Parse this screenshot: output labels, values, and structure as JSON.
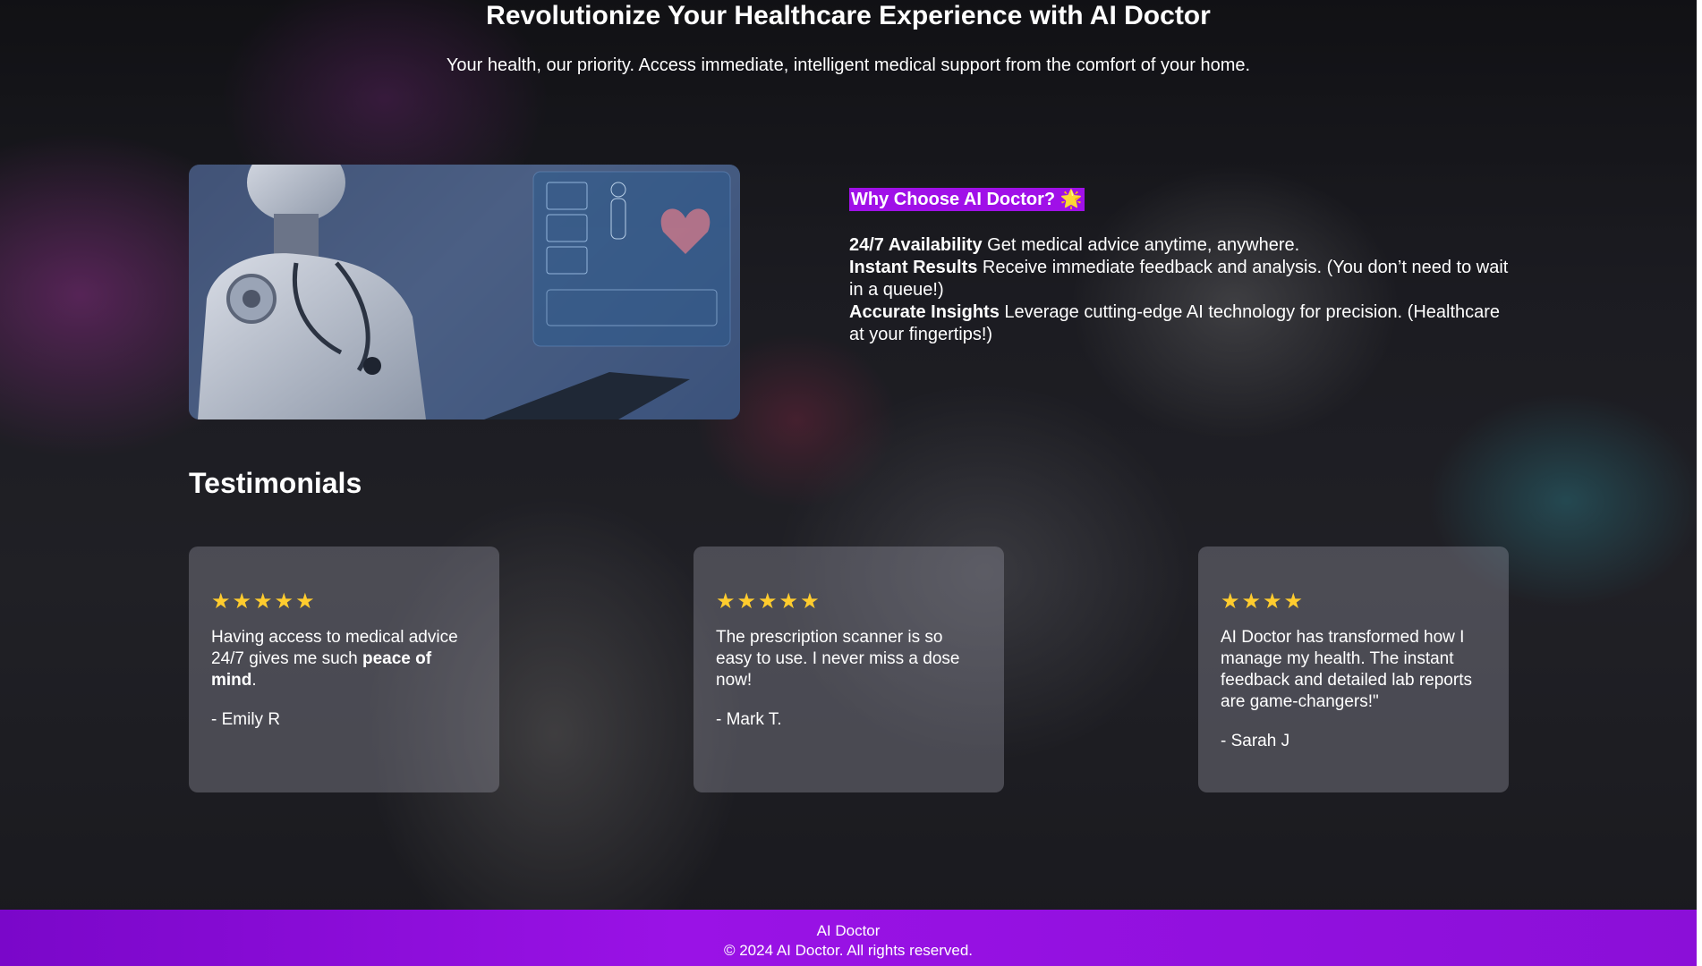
{
  "hero": {
    "title": "Revolutionize Your Healthcare Experience with AI Doctor",
    "subtitle": "Your health, our priority. Access immediate, intelligent medical support from the comfort of your home."
  },
  "why": {
    "heading": "Why Choose AI Doctor? 🌟",
    "items": [
      {
        "title": "24/7 Availability",
        "text": "Get medical advice anytime, anywhere."
      },
      {
        "title": "Instant Results",
        "text": "Receive immediate feedback and analysis. (You don’t need to wait in a queue!)"
      },
      {
        "title": "Accurate Insights",
        "text": "Leverage cutting-edge AI technology for precision. (Healthcare at your fingertips!)"
      }
    ],
    "heading_bg": "#a010e8"
  },
  "testimonials": {
    "heading": "Testimonials",
    "star_color": "#ffcc2e",
    "cards": [
      {
        "stars": "★★★★★",
        "rating": 5,
        "quote_pre": "Having access to medical advice 24/7 gives me such ",
        "quote_bold": "peace of mind",
        "quote_post": ".",
        "author": "- Emily R"
      },
      {
        "stars": "★★★★★",
        "rating": 5,
        "quote": "The prescription scanner is so easy to use. I never miss a dose now!",
        "author": "- Mark T."
      },
      {
        "stars": "★★★★",
        "rating": 4,
        "quote": "AI Doctor has transformed how I manage my health. The instant feedback and detailed lab reports are game-changers!\"",
        "author": "- Sarah J"
      }
    ]
  },
  "footer": {
    "name": "AI Doctor",
    "copyright": "© 2024 AI Doctor. All rights reserved.",
    "color": "#8b0fd8"
  }
}
